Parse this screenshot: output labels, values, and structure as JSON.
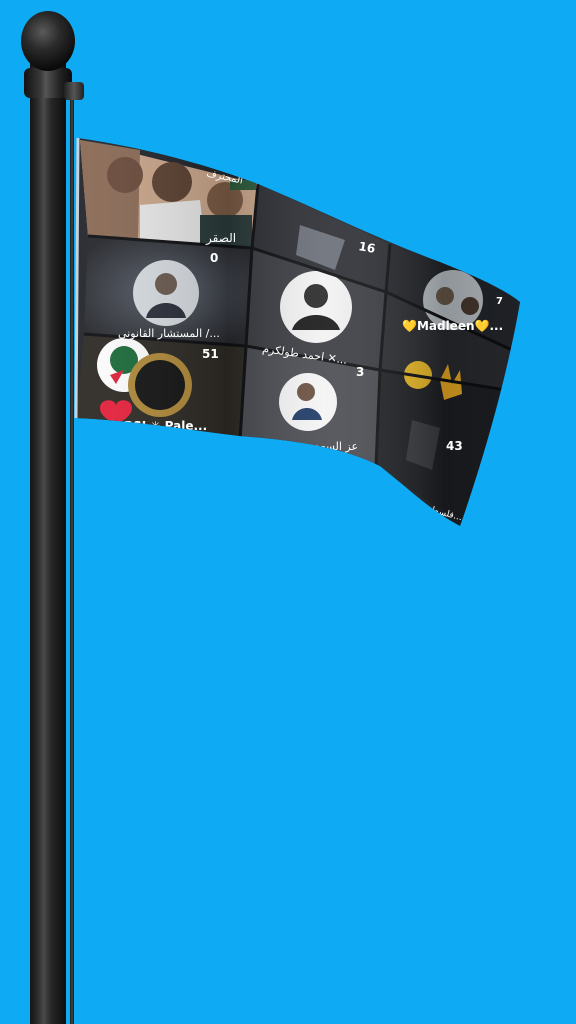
{
  "flag": {
    "tiles": [
      {
        "label": "الصقر",
        "count": "",
        "top_label": "المحترف"
      },
      {
        "label": "",
        "count": "16"
      },
      {
        "label": "",
        "count": ""
      },
      {
        "label": "المستشار القانوني /...",
        "count": "0"
      },
      {
        "label": "احمد طولكرم ✕...",
        "count": ""
      },
      {
        "label": "💛Madleen💛...",
        "count": "7"
      },
      {
        "label": "BSI ✳ Pale...",
        "count": "51"
      },
      {
        "label": "عز السعدي",
        "count": "3"
      },
      {
        "label": "فلسط...",
        "count": "43"
      }
    ]
  }
}
